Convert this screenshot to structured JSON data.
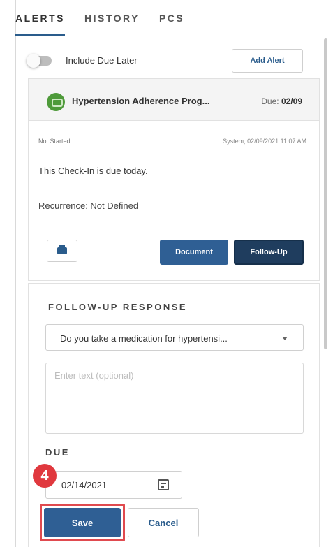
{
  "tabs": [
    {
      "label": "ALERTS",
      "active": true
    },
    {
      "label": "HISTORY",
      "active": false
    },
    {
      "label": "PCS",
      "active": false
    }
  ],
  "toolbar": {
    "toggle_label": "Include Due Later",
    "toggle_on": false,
    "add_alert_label": "Add Alert"
  },
  "alert": {
    "title": "Hypertension Adherence Prog...",
    "due_prefix": "Due:",
    "due_date": "02/09",
    "status": "Not Started",
    "source": "System, 02/09/2021 11:07 AM",
    "message": "This Check-In is due today.",
    "recurrence": "Recurrence: Not Defined",
    "document_label": "Document",
    "follow_up_label": "Follow-Up"
  },
  "follow_up": {
    "section_title": "FOLLOW-UP RESPONSE",
    "question_selected": "Do you take a medication for hypertensi...",
    "text_placeholder": "Enter text (optional)",
    "due_label": "DUE",
    "due_value": "02/14/2021",
    "save_label": "Save",
    "cancel_label": "Cancel"
  },
  "annotation": {
    "step_number": "4",
    "colors": {
      "badge": "#e0383e",
      "highlight": "#e04a4f"
    }
  },
  "colors": {
    "primary": "#2f5f94",
    "primary_dark": "#1f3d5e",
    "program_icon": "#4e9a3a"
  }
}
